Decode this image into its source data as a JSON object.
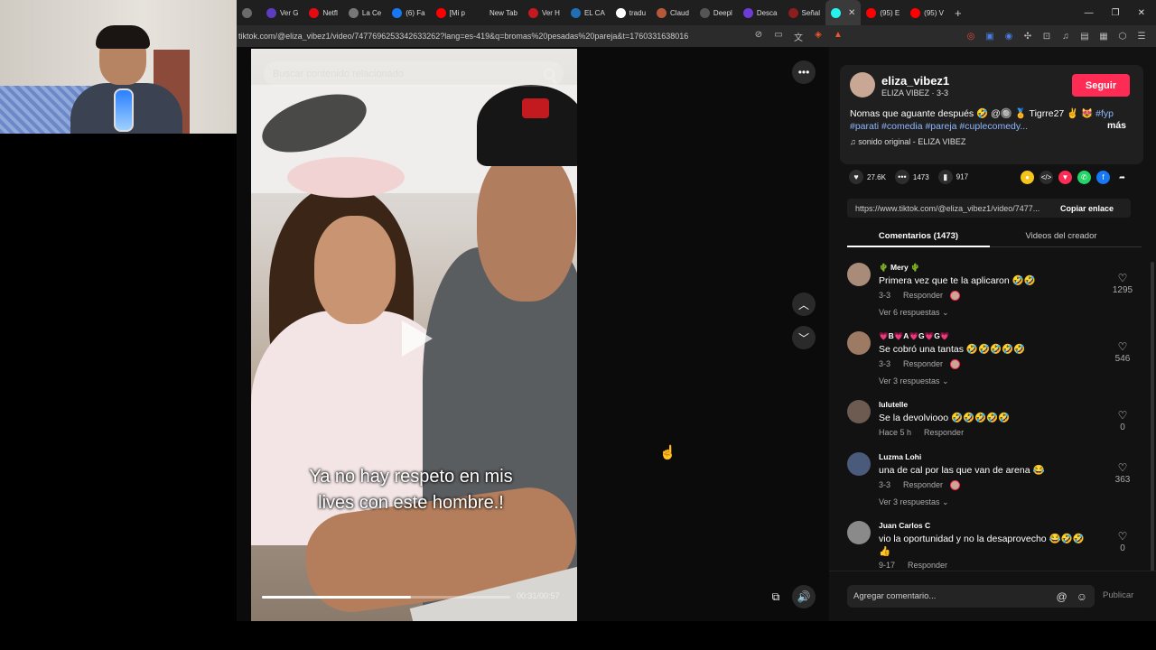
{
  "browser": {
    "tabs": [
      {
        "label": "",
        "color": "#6b6b6b"
      },
      {
        "label": "Ver G",
        "color": "#5c3cbf"
      },
      {
        "label": "Netfl",
        "color": "#e50914"
      },
      {
        "label": "La Ce",
        "color": "#777777"
      },
      {
        "label": "(6) Fa",
        "color": "#1877f2"
      },
      {
        "label": "[Mi p",
        "color": "#ff0000"
      },
      {
        "label": "New Tab",
        "color": "#1f1f1f"
      },
      {
        "label": "Ver H",
        "color": "#c31a20"
      },
      {
        "label": "EL CA",
        "color": "#1e6fb5"
      },
      {
        "label": "tradu",
        "color": "#ffffff"
      },
      {
        "label": "Claud",
        "color": "#b5593a"
      },
      {
        "label": "Deepl",
        "color": "#555555"
      },
      {
        "label": "Desca",
        "color": "#6d3bd6"
      },
      {
        "label": "Señal",
        "color": "#8b1e1e"
      },
      {
        "label": "",
        "color": "#25f4ee"
      },
      {
        "label": "(95) E",
        "color": "#ff0000"
      },
      {
        "label": "(95) V",
        "color": "#ff0000"
      }
    ],
    "url": "tiktok.com/@eliza_vibez1/video/7477696253342633262?lang=es-419&q=bromas%20pesadas%20pareja&t=1760331638016"
  },
  "video": {
    "search_placeholder": "Buscar contenido relacionado",
    "caption_line1": "Ya no hay respeto en mis",
    "caption_line2": "lives con este hombre.!",
    "time": "00:31/00:57",
    "progress": 0.6
  },
  "creator": {
    "username": "eliza_vibez1",
    "subline": "ELIZA VIBEZ · 3-3",
    "follow_label": "Seguir",
    "desc_text": "Nomas que aguante después 🤣 @🔘 🏅 Tigrre27 ✌️ 😻 ",
    "desc_tags": "#fyp #parati #comedia #pareja #cuplecomedy...",
    "more_label": "más",
    "sound": "sonido original - ELIZA VIBEZ"
  },
  "stats": {
    "likes": "27.6K",
    "comments": "1473",
    "saves": "917"
  },
  "share": {
    "link": "https://www.tiktok.com/@eliza_vibez1/video/7477...",
    "copy_label": "Copiar enlace"
  },
  "panel_tabs": {
    "comments": "Comentarios (1473)",
    "videos": "Videos del creador"
  },
  "comments": [
    {
      "name": "🌵 Mery 🌵",
      "text": "Primera vez que te la aplicaron 🤣🤣",
      "date": "3-3",
      "reply": "Responder",
      "creator_liked": true,
      "replies": "Ver 6 respuestas ⌄",
      "likes": "1295",
      "avatar_color": "#a88b78"
    },
    {
      "name": "💗B💗A💗G💗G💗",
      "text": "Se cobró una tantas 🤣🤣🤣🤣🤣",
      "date": "3-3",
      "reply": "Responder",
      "creator_liked": true,
      "replies": "Ver 3 respuestas ⌄",
      "likes": "546",
      "avatar_color": "#9c7a64"
    },
    {
      "name": "lulutelle",
      "text": "Se la devolviooo 🤣🤣🤣🤣🤣",
      "date": "Hace 5 h",
      "reply": "Responder",
      "creator_liked": false,
      "replies": "",
      "likes": "0",
      "avatar_color": "#6d5a50"
    },
    {
      "name": "Luzma Lohi",
      "text": "una de cal por las que van de arena 😂",
      "date": "3-3",
      "reply": "Responder",
      "creator_liked": true,
      "replies": "Ver 3 respuestas ⌄",
      "likes": "363",
      "avatar_color": "#4a5a7a"
    },
    {
      "name": "Juan Carlos C",
      "text": "vio la oportunidad y no la desaprovecho 😂🤣🤣",
      "text2": "👍",
      "date": "9-17",
      "reply": "Responder",
      "creator_liked": false,
      "replies": "",
      "likes": "0",
      "avatar_color": "#8a8a8a"
    }
  ],
  "comment_bar": {
    "placeholder": "Agregar comentario...",
    "publish": "Publicar"
  }
}
